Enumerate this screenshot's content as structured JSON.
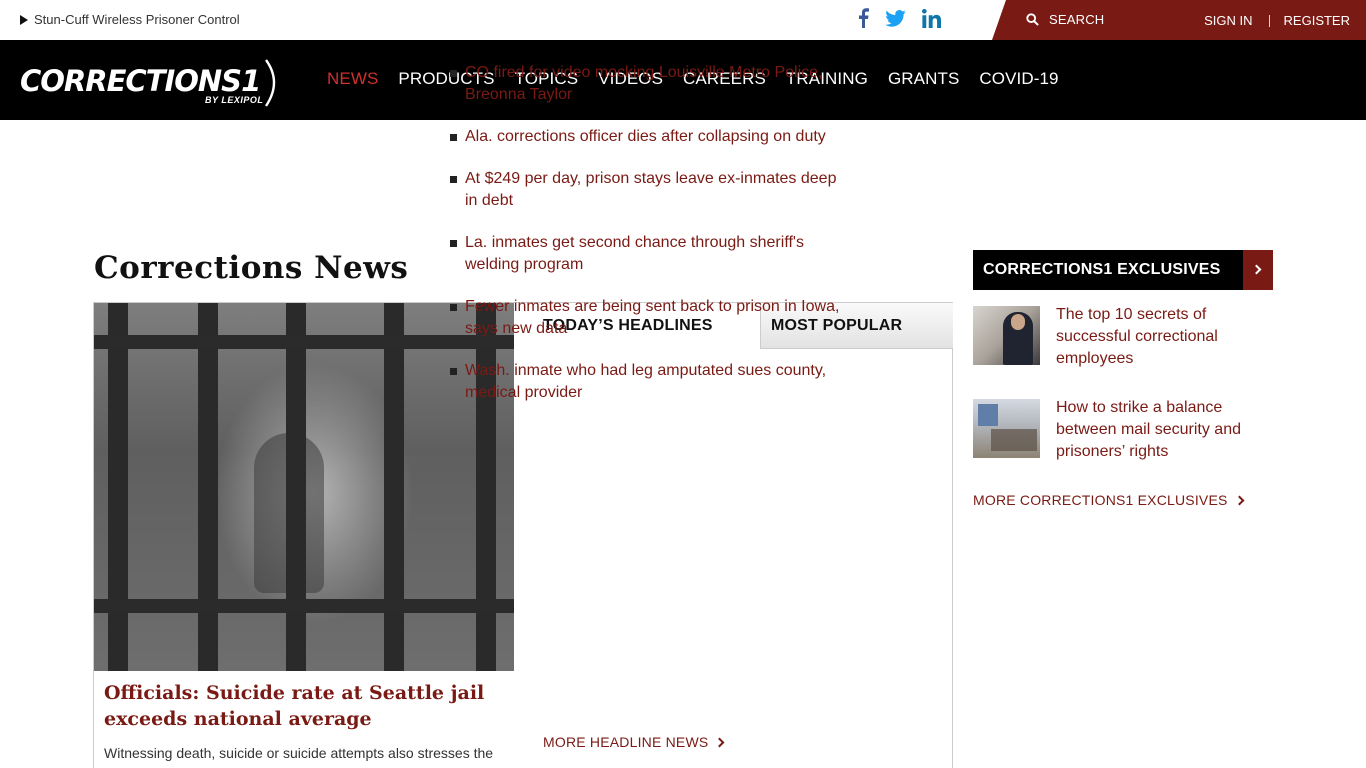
{
  "topbar": {
    "promo": "Stun-Cuff Wireless Prisoner Control",
    "social": [
      "facebook-icon",
      "twitter-icon",
      "linkedin-icon"
    ],
    "search_label": "SEARCH",
    "sign_in": "SIGN IN",
    "register": "REGISTER"
  },
  "brand": {
    "name": "CORRECTIONS1",
    "byline": "BY LEXIPOL",
    "accent": "#7a1a14",
    "nav_active": "#d0312d"
  },
  "nav": {
    "items": [
      "NEWS",
      "PRODUCTS",
      "TOPICS",
      "VIDEOS",
      "CAREERS",
      "TRAINING",
      "GRANTS",
      "COVID-19"
    ],
    "active": "NEWS"
  },
  "main": {
    "title": "Corrections News",
    "hero": {
      "title": "Officials: Suicide rate at Seattle jail exceeds national average",
      "description": "Witnessing death, suicide or suicide attempts also stresses the jail population of COs..."
    },
    "tabs": [
      "TODAY’S HEADLINES",
      "MOST POPULAR"
    ],
    "headlines": [
      "CO fired for video mocking Louisville Metro Police, Breonna Taylor",
      "Ala. corrections officer dies after collapsing on duty",
      "At $249 per day, prison stays leave ex-inmates deep in debt",
      "La. inmates get second chance through sheriff's welding program",
      "Fewer inmates are being sent back to prison in Iowa, says new data",
      "Wash. inmate who had leg amputated sues county, medical provider"
    ],
    "more_headlines": "MORE HEADLINE NEWS"
  },
  "sidebar": {
    "title": "CORRECTIONS1 EXCLUSIVES",
    "items": [
      "The top 10 secrets of successful correctional employees",
      "How to strike a balance between mail security and prisoners’ rights"
    ],
    "more": "MORE CORRECTIONS1 EXCLUSIVES"
  }
}
